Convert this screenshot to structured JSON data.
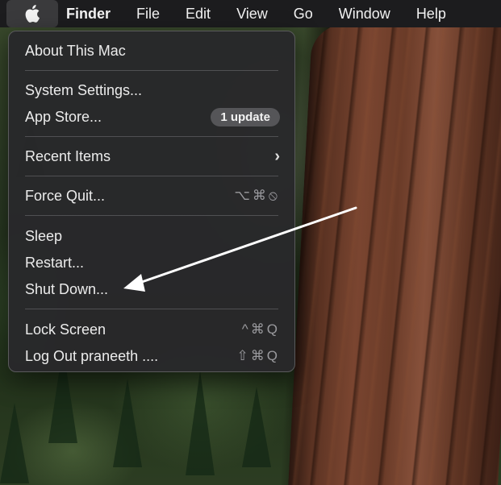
{
  "menubar": {
    "apple_icon": "apple-logo-icon",
    "items": [
      "Finder",
      "File",
      "Edit",
      "View",
      "Go",
      "Window",
      "Help"
    ]
  },
  "apple_menu": {
    "about": "About This Mac",
    "system_settings": "System Settings...",
    "app_store": "App Store...",
    "app_store_badge": "1 update",
    "recent_items": "Recent Items",
    "recent_items_icon": "chevron-right-icon",
    "force_quit": "Force Quit...",
    "force_quit_shortcut": "⌥⌘⦸",
    "sleep": "Sleep",
    "restart": "Restart...",
    "shut_down": "Shut Down...",
    "lock_screen": "Lock Screen",
    "lock_screen_shortcut": "^⌘Q",
    "log_out": "Log Out praneeth ....",
    "log_out_shortcut": "⇧⌘Q"
  },
  "annotation": {
    "arrow_icon": "arrow-icon",
    "color": "#ffffff"
  }
}
